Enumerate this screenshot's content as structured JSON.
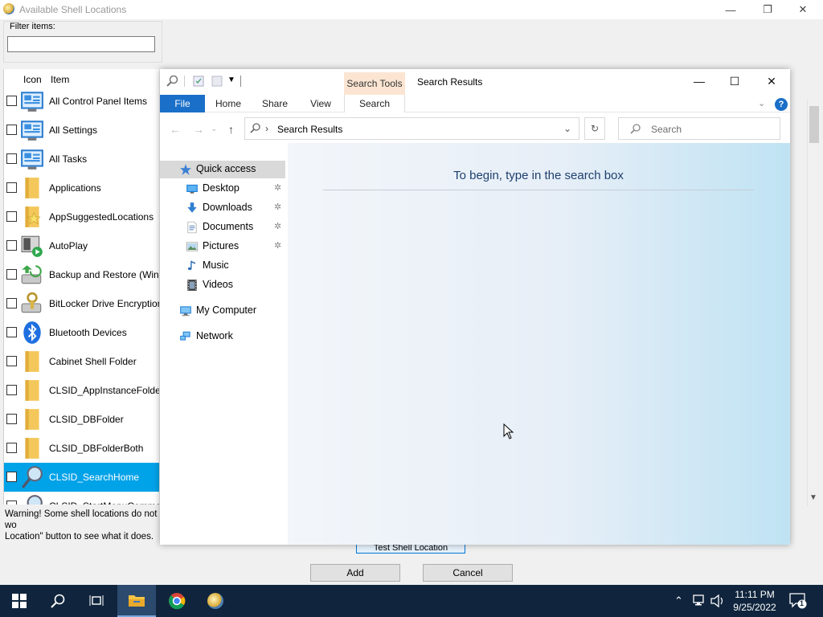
{
  "dialog": {
    "title": "Available Shell Locations",
    "filter_label": "Filter items:",
    "filter_value": "",
    "columns": [
      "Icon",
      "Item"
    ],
    "items": [
      {
        "label": "All Control Panel Items",
        "icon": "control-panel-icon",
        "checked": false,
        "selected": false
      },
      {
        "label": "All Settings",
        "icon": "control-panel-icon",
        "checked": false,
        "selected": false
      },
      {
        "label": "All Tasks",
        "icon": "control-panel-icon",
        "checked": false,
        "selected": false
      },
      {
        "label": "Applications",
        "icon": "folder-icon",
        "checked": false,
        "selected": false
      },
      {
        "label": "AppSuggestedLocations",
        "icon": "folder-star-icon",
        "checked": false,
        "selected": false
      },
      {
        "label": "AutoPlay",
        "icon": "autoplay-icon",
        "checked": false,
        "selected": false
      },
      {
        "label": "Backup and Restore (Window",
        "icon": "backup-icon",
        "checked": false,
        "selected": false
      },
      {
        "label": "BitLocker Drive Encryption",
        "icon": "bitlocker-icon",
        "checked": false,
        "selected": false
      },
      {
        "label": "Bluetooth Devices",
        "icon": "bluetooth-icon",
        "checked": false,
        "selected": false
      },
      {
        "label": "Cabinet Shell Folder",
        "icon": "folder-icon",
        "checked": false,
        "selected": false
      },
      {
        "label": "CLSID_AppInstanceFolder",
        "icon": "folder-icon",
        "checked": false,
        "selected": false
      },
      {
        "label": "CLSID_DBFolder",
        "icon": "folder-icon",
        "checked": false,
        "selected": false
      },
      {
        "label": "CLSID_DBFolderBoth",
        "icon": "folder-icon",
        "checked": false,
        "selected": false
      },
      {
        "label": "CLSID_SearchHome",
        "icon": "search-icon",
        "checked": false,
        "selected": true
      },
      {
        "label": "CLSID_StartMenuCommandi",
        "icon": "search-icon",
        "checked": false,
        "selected": false
      }
    ],
    "warning_line1": "Warning! Some shell locations do not wo",
    "warning_line2": "Location\" button to see what it does.",
    "test_button": "Test Shell Location",
    "add_button": "Add",
    "cancel_button": "Cancel"
  },
  "explorer": {
    "context_tab": "Search Tools",
    "title": "Search Results",
    "tabs": [
      "File",
      "Home",
      "Share",
      "View",
      "Search"
    ],
    "address": "Search Results",
    "search_placeholder": "Search",
    "nav": [
      {
        "label": "Quick access",
        "icon": "star-icon",
        "pinned": false,
        "selected": true
      },
      {
        "label": "Desktop",
        "icon": "desktop-icon",
        "pinned": true,
        "selected": false
      },
      {
        "label": "Downloads",
        "icon": "download-icon",
        "pinned": true,
        "selected": false
      },
      {
        "label": "Documents",
        "icon": "document-icon",
        "pinned": true,
        "selected": false
      },
      {
        "label": "Pictures",
        "icon": "picture-icon",
        "pinned": true,
        "selected": false
      },
      {
        "label": "Music",
        "icon": "music-icon",
        "pinned": false,
        "selected": false
      },
      {
        "label": "Videos",
        "icon": "video-icon",
        "pinned": false,
        "selected": false
      },
      {
        "label": "My Computer",
        "icon": "computer-icon",
        "pinned": false,
        "selected": false
      },
      {
        "label": "Network",
        "icon": "network-icon",
        "pinned": false,
        "selected": false
      }
    ],
    "empty_message": "To begin, type in the search box"
  },
  "taskbar": {
    "time": "11:11 PM",
    "date": "9/25/2022",
    "notification_count": "1"
  }
}
